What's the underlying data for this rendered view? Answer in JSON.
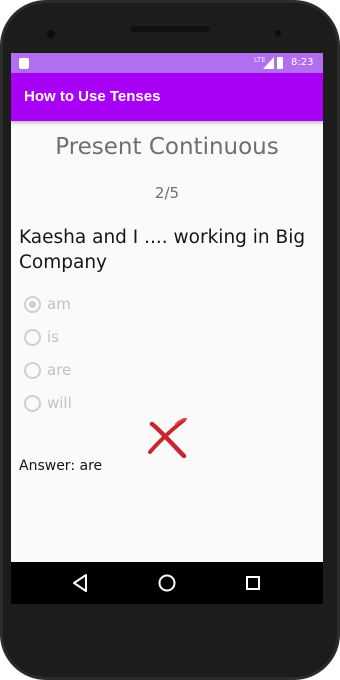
{
  "status_bar": {
    "time": "8:23",
    "network": "LTE",
    "colors": {
      "background": "#b16ef0"
    },
    "icons": [
      "notification-icon",
      "signal-icon",
      "battery-icon"
    ]
  },
  "app_bar": {
    "title": "How to Use Tenses",
    "color": "#a800f4"
  },
  "quiz": {
    "topic": "Present Continuous",
    "progress": "2/5",
    "question": "Kaesha and I .... working in Big Company",
    "options": [
      {
        "label": "am",
        "selected": true
      },
      {
        "label": "is",
        "selected": false
      },
      {
        "label": "are",
        "selected": false
      },
      {
        "label": "will",
        "selected": false
      }
    ],
    "result_icon": "wrong-cross-icon",
    "answer_text": "Answer: are"
  },
  "nav_bar": {
    "buttons": [
      "back-icon",
      "home-icon",
      "recents-icon"
    ]
  }
}
